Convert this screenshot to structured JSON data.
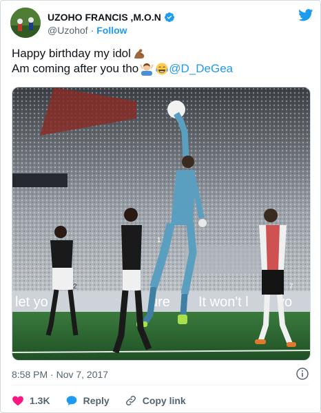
{
  "user": {
    "display_name": "UZOHO FRANCIS ,M.O.N",
    "handle": "@Uzohof",
    "separator": "·",
    "follow_label": "Follow"
  },
  "tweet": {
    "line1": "Happy birthday my idol",
    "line2": "Am coming after you tho",
    "mention": "@D_DeGea",
    "emojis": [
      "flexed-biceps-icon",
      "man-gesturing-ok-icon",
      "face-with-tears-of-joy-icon"
    ]
  },
  "media": {
    "banner_left": "let yo",
    "banner_mid": "ure",
    "banner_right": "It won't l",
    "banner_far": "yo",
    "player1_number": "1",
    "player2_number": "7",
    "player3_number": "2"
  },
  "meta": {
    "timestamp": "8:58 PM · Nov 7, 2017"
  },
  "actions": {
    "like_count": "1.3K",
    "reply_label": "Reply",
    "copy_link_label": "Copy link"
  },
  "colors": {
    "brand_blue": "#1d9bf0",
    "like_red": "#f91880",
    "text_primary": "#0f1419",
    "text_secondary": "#536471"
  }
}
